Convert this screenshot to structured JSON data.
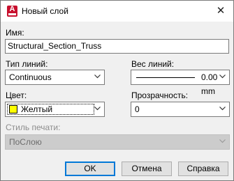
{
  "window": {
    "title": "Новый слой",
    "close_glyph": "✕"
  },
  "form": {
    "name_label": "Имя:",
    "name_value": "Structural_Section_Truss",
    "linetype_label": "Тип линий:",
    "linetype_value": "Continuous",
    "lineweight_label": "Вес линий:",
    "lineweight_value": "0.00 mm",
    "color_label": "Цвет:",
    "color_value": "Желтый",
    "color_swatch": "#ffff00",
    "transparency_label": "Прозрачность:",
    "transparency_value": "0",
    "plotstyle_label": "Стиль печати:",
    "plotstyle_value": "ПоСлою"
  },
  "buttons": {
    "ok": "OK",
    "cancel": "Отмена",
    "help": "Справка"
  },
  "icons": {
    "app": "autocad-app-icon",
    "close": "close-icon",
    "dropdown": "chevron-down-icon"
  },
  "colors": {
    "accent": "#0078d7",
    "app_icon": "#c8102e",
    "dialog_bg": "#f0f0f0"
  }
}
